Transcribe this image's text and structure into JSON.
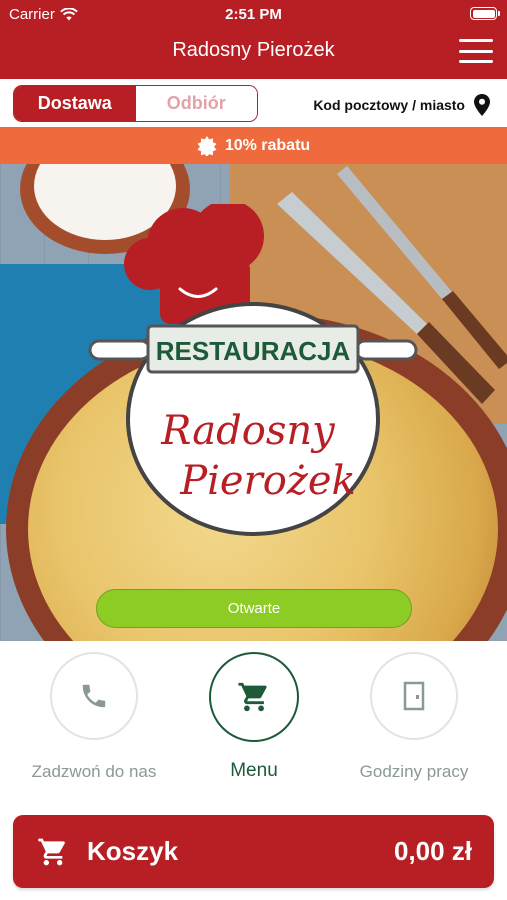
{
  "status_bar": {
    "carrier": "Carrier",
    "time": "2:51 PM"
  },
  "header": {
    "title": "Radosny Pierożek"
  },
  "delivery_toggle": {
    "delivery_label": "Dostawa",
    "pickup_label": "Odbiór",
    "selected": "Dostawa"
  },
  "postcode": {
    "label": "Kod pocztowy / miasto"
  },
  "discount": {
    "label": "10% rabatu"
  },
  "logo": {
    "top_text": "RESTAURACJA",
    "line1": "Radosny",
    "line2": "Pierożek"
  },
  "hero": {
    "status_button_label": "Otwarte"
  },
  "actions": [
    {
      "label": "Zadzwoń do nas",
      "icon": "phone-icon"
    },
    {
      "label": "Menu",
      "icon": "cart-icon"
    },
    {
      "label": "Godziny pracy",
      "icon": "door-icon"
    }
  ],
  "cart": {
    "label": "Koszyk",
    "total": "0,00 zł"
  },
  "colors": {
    "primary": "#b71f25",
    "discount": "#ef6a3c",
    "open": "#8dcc25",
    "menu_green": "#1d5a3a"
  }
}
